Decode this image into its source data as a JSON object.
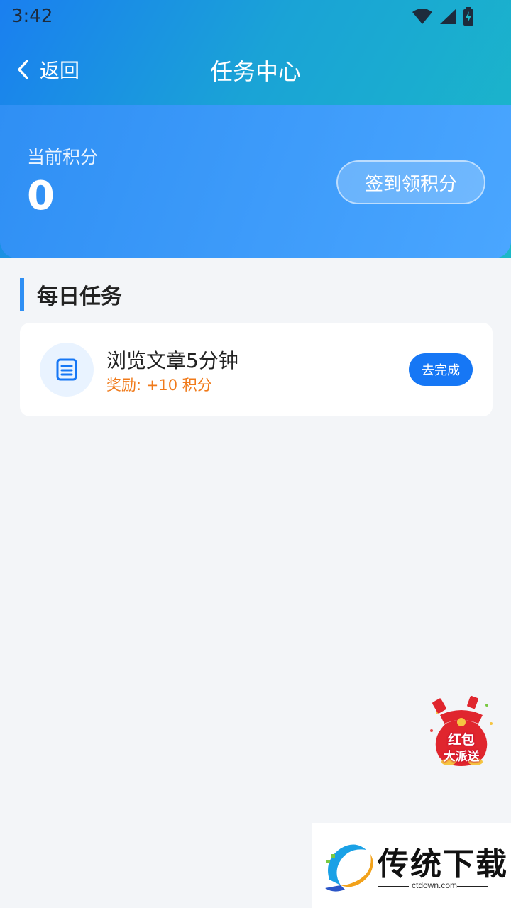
{
  "status_bar": {
    "time": "3:42"
  },
  "navbar": {
    "back_label": "返回",
    "title": "任务中心"
  },
  "points": {
    "label": "当前积分",
    "value": "0",
    "signin_label": "签到领积分"
  },
  "daily_tasks": {
    "title": "每日任务",
    "tasks": [
      {
        "title": "浏览文章5分钟",
        "reward": "奖励: +10 积分",
        "action": "去完成",
        "icon": "article-icon"
      }
    ]
  },
  "floating": {
    "redpacket_line1": "红包",
    "redpacket_line2": "大派送"
  },
  "watermark": {
    "name": "传统下载",
    "url": "ctdown.com"
  },
  "colors": {
    "primary": "#1677f5",
    "reward": "#f07a1a",
    "background": "#f3f5f8"
  }
}
